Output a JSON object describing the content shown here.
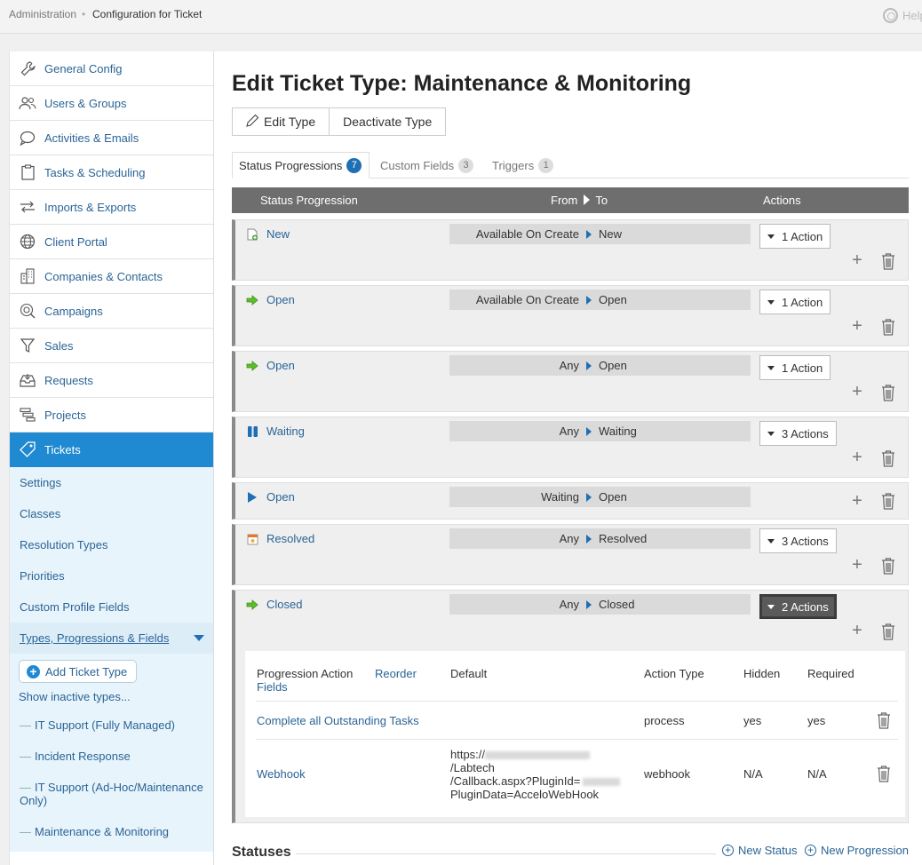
{
  "breadcrumb": {
    "root": "Administration",
    "separator": "•",
    "current": "Configuration for Ticket"
  },
  "help": {
    "label": "Help"
  },
  "sidebar": {
    "items": [
      {
        "label": "General Config",
        "icon": "wrench-icon"
      },
      {
        "label": "Users & Groups",
        "icon": "users-icon"
      },
      {
        "label": "Activities & Emails",
        "icon": "chat-icon"
      },
      {
        "label": "Tasks & Scheduling",
        "icon": "clipboard-icon"
      },
      {
        "label": "Imports & Exports",
        "icon": "transfer-icon"
      },
      {
        "label": "Client Portal",
        "icon": "globe-icon"
      },
      {
        "label": "Companies & Contacts",
        "icon": "building-icon"
      },
      {
        "label": "Campaigns",
        "icon": "campaign-icon"
      },
      {
        "label": "Sales",
        "icon": "funnel-icon"
      },
      {
        "label": "Requests",
        "icon": "inbox-icon"
      },
      {
        "label": "Projects",
        "icon": "gantt-icon"
      },
      {
        "label": "Tickets",
        "icon": "tag-icon"
      }
    ],
    "ticket_sub": [
      "Settings",
      "Classes",
      "Resolution Types",
      "Priorities",
      "Custom Profile Fields"
    ],
    "types_label": "Types, Progressions & Fields",
    "add_type": "Add Ticket Type",
    "show_inactive": "Show inactive types...",
    "types": [
      "IT Support (Fully Managed)",
      "Incident Response",
      "IT Support (Ad-Hoc/Maintenance Only)",
      "Maintenance & Monitoring"
    ]
  },
  "main": {
    "title": "Edit Ticket Type: Maintenance & Monitoring",
    "edit_type": "Edit Type",
    "deactivate_type": "Deactivate Type",
    "tabs": [
      {
        "label": "Status Progressions",
        "count": "7"
      },
      {
        "label": "Custom Fields",
        "count": "3"
      },
      {
        "label": "Triggers",
        "count": "1"
      }
    ],
    "table": {
      "col_status": "Status Progression",
      "col_from": "From",
      "col_to": "To",
      "col_actions": "Actions"
    },
    "rows": [
      {
        "status": "New",
        "from": "Available On Create",
        "to": "New",
        "actions": "1 Action",
        "icon": "new-doc-icon"
      },
      {
        "status": "Open",
        "from": "Available On Create",
        "to": "Open",
        "actions": "1 Action",
        "icon": "green-arrow-icon"
      },
      {
        "status": "Open",
        "from": "Any",
        "to": "Open",
        "actions": "1 Action",
        "icon": "green-arrow-icon"
      },
      {
        "status": "Waiting",
        "from": "Any",
        "to": "Waiting",
        "actions": "3 Actions",
        "icon": "pause-icon"
      },
      {
        "status": "Open",
        "from": "Waiting",
        "to": "Open",
        "actions": "",
        "icon": "play-icon"
      },
      {
        "status": "Resolved",
        "from": "Any",
        "to": "Resolved",
        "actions": "3 Actions",
        "icon": "resolved-icon"
      },
      {
        "status": "Closed",
        "from": "Any",
        "to": "Closed",
        "actions": "2 Actions",
        "icon": "green-arrow-icon"
      }
    ],
    "detail": {
      "h_action": "Progression Action",
      "h_reorder": "Reorder",
      "h_fields": "Fields",
      "h_default": "Default",
      "h_type": "Action Type",
      "h_hidden": "Hidden",
      "h_required": "Required",
      "rows": [
        {
          "name": "Complete all Outstanding Tasks",
          "default": "",
          "type": "process",
          "hidden": "yes",
          "required": "yes"
        },
        {
          "name": "Webhook",
          "url1": "https://",
          "url2": "/Labtech",
          "url3": "/Callback.aspx?PluginId=",
          "url4": "PluginData=AcceloWebHook",
          "type": "webhook",
          "hidden": "N/A",
          "required": "N/A"
        }
      ]
    },
    "statuses_label": "Statuses",
    "new_status": "New Status",
    "new_progression": "New Progression"
  }
}
